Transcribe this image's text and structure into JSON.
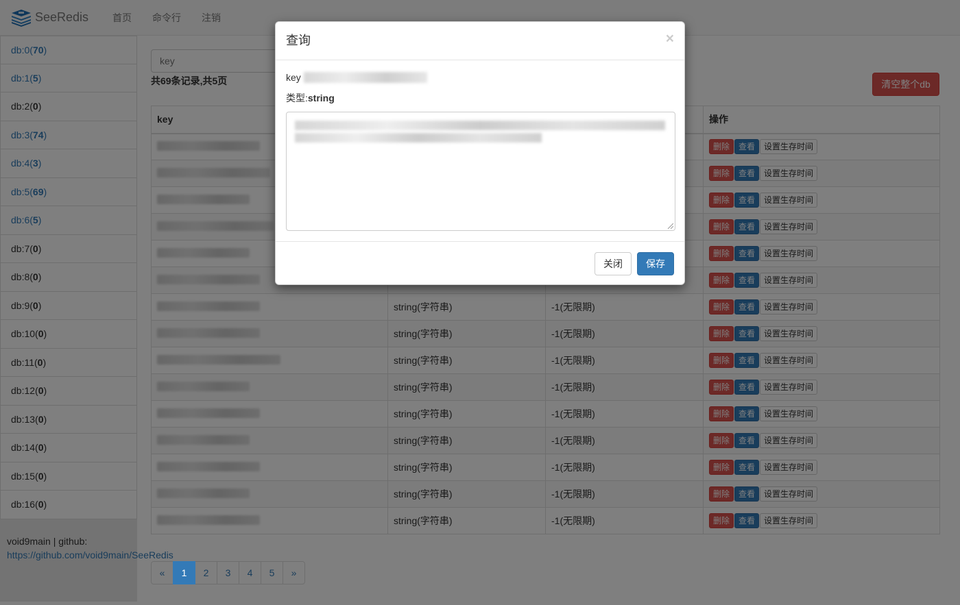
{
  "navbar": {
    "brand": "SeeRedis",
    "brand_icon": "redis-logo-icon",
    "links": [
      "首页",
      "命令行",
      "注销"
    ]
  },
  "sidebar": {
    "dbs": [
      {
        "name": "db:0",
        "count": "70"
      },
      {
        "name": "db:1",
        "count": "5"
      },
      {
        "name": "db:2",
        "count": "0"
      },
      {
        "name": "db:3",
        "count": "74"
      },
      {
        "name": "db:4",
        "count": "3"
      },
      {
        "name": "db:5",
        "count": "69"
      },
      {
        "name": "db:6",
        "count": "5"
      },
      {
        "name": "db:7",
        "count": "0"
      },
      {
        "name": "db:8",
        "count": "0"
      },
      {
        "name": "db:9",
        "count": "0"
      },
      {
        "name": "db:10",
        "count": "0"
      },
      {
        "name": "db:11",
        "count": "0"
      },
      {
        "name": "db:12",
        "count": "0"
      },
      {
        "name": "db:13",
        "count": "0"
      },
      {
        "name": "db:14",
        "count": "0"
      },
      {
        "name": "db:15",
        "count": "0"
      },
      {
        "name": "db:16",
        "count": "0"
      }
    ],
    "footer_text": "void9main | github:",
    "footer_link": "https://github.com/void9main/SeeRedis"
  },
  "main": {
    "search_placeholder": "key",
    "summary": "共69条记录,共5页",
    "clear_button": "清空整个db",
    "table": {
      "headers": [
        "key",
        "",
        "",
        "操作"
      ],
      "rows": [
        {
          "type": "",
          "ttl": ""
        },
        {
          "type": "",
          "ttl": ""
        },
        {
          "type": "",
          "ttl": ""
        },
        {
          "type": "",
          "ttl": ""
        },
        {
          "type": "",
          "ttl": ""
        },
        {
          "type": "",
          "ttl": ""
        },
        {
          "type": "string(字符串)",
          "ttl": "-1(无限期)"
        },
        {
          "type": "string(字符串)",
          "ttl": "-1(无限期)"
        },
        {
          "type": "string(字符串)",
          "ttl": "-1(无限期)"
        },
        {
          "type": "string(字符串)",
          "ttl": "-1(无限期)"
        },
        {
          "type": "string(字符串)",
          "ttl": "-1(无限期)"
        },
        {
          "type": "string(字符串)",
          "ttl": "-1(无限期)"
        },
        {
          "type": "string(字符串)",
          "ttl": "-1(无限期)"
        },
        {
          "type": "string(字符串)",
          "ttl": "-1(无限期)"
        },
        {
          "type": "string(字符串)",
          "ttl": "-1(无限期)"
        }
      ],
      "actions": {
        "delete": "删除",
        "view": "查看",
        "ttl": "设置生存时间"
      }
    },
    "pagination": {
      "prev": "«",
      "pages": [
        "1",
        "2",
        "3",
        "4",
        "5"
      ],
      "active": "1",
      "next": "»"
    }
  },
  "modal": {
    "title": "查询",
    "close": "×",
    "key_label": "key",
    "type_label": "类型:",
    "type_value": "string",
    "buttons": {
      "close": "关闭",
      "save": "保存"
    }
  },
  "colors": {
    "primary": "#337ab7",
    "danger": "#d9534f",
    "backdrop": "rgba(0,0,0,0.5)"
  }
}
